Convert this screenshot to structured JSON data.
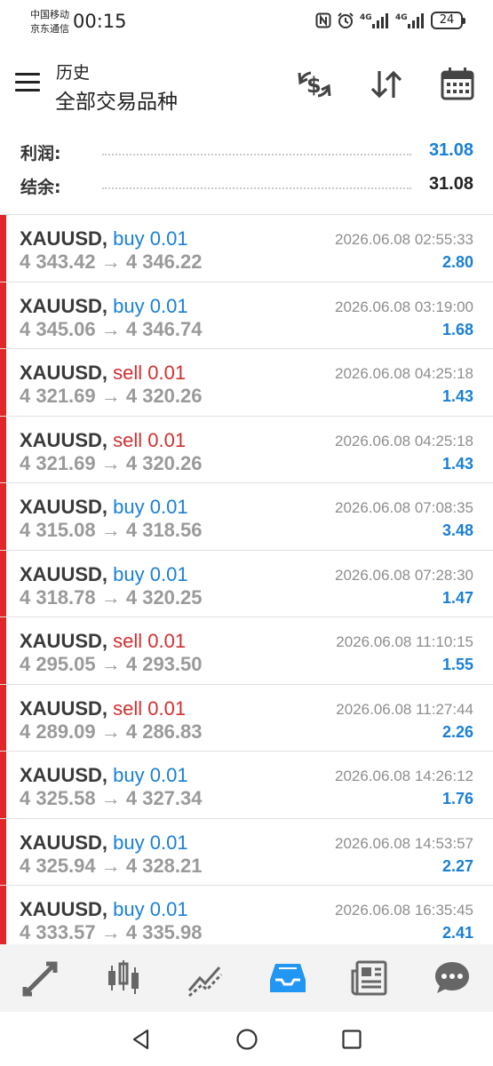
{
  "status_bar": {
    "carrier_1": "中国移动",
    "carrier_2": "京东通信",
    "time": "00:15",
    "signal_1_label": "4G",
    "signal_2_label": "4G",
    "battery": "24"
  },
  "header": {
    "subtitle": "历史",
    "title": "全部交易品种"
  },
  "summary": {
    "profit_label": "利润:",
    "profit_value": "31.08",
    "balance_label": "结余:",
    "balance_value": "31.08",
    "profit_color": "#1a80d6"
  },
  "colors": {
    "buy": "#1a80d6",
    "sell": "#d32f2f",
    "accent_bar": "#e02828",
    "nav_active": "#2196f3"
  },
  "deals": [
    {
      "symbol": "XAUUSD,",
      "type": "buy",
      "volume": "0.01",
      "prices": "4 343.42 → 4 346.22",
      "time": "2026.06.08 02:55:33",
      "profit": "2.80"
    },
    {
      "symbol": "XAUUSD,",
      "type": "buy",
      "volume": "0.01",
      "prices": "4 345.06 → 4 346.74",
      "time": "2026.06.08 03:19:00",
      "profit": "1.68"
    },
    {
      "symbol": "XAUUSD,",
      "type": "sell",
      "volume": "0.01",
      "prices": "4 321.69 → 4 320.26",
      "time": "2026.06.08 04:25:18",
      "profit": "1.43"
    },
    {
      "symbol": "XAUUSD,",
      "type": "sell",
      "volume": "0.01",
      "prices": "4 321.69 → 4 320.26",
      "time": "2026.06.08 04:25:18",
      "profit": "1.43"
    },
    {
      "symbol": "XAUUSD,",
      "type": "buy",
      "volume": "0.01",
      "prices": "4 315.08 → 4 318.56",
      "time": "2026.06.08 07:08:35",
      "profit": "3.48"
    },
    {
      "symbol": "XAUUSD,",
      "type": "buy",
      "volume": "0.01",
      "prices": "4 318.78 → 4 320.25",
      "time": "2026.06.08 07:28:30",
      "profit": "1.47"
    },
    {
      "symbol": "XAUUSD,",
      "type": "sell",
      "volume": "0.01",
      "prices": "4 295.05 → 4 293.50",
      "time": "2026.06.08 11:10:15",
      "profit": "1.55"
    },
    {
      "symbol": "XAUUSD,",
      "type": "sell",
      "volume": "0.01",
      "prices": "4 289.09 → 4 286.83",
      "time": "2026.06.08 11:27:44",
      "profit": "2.26"
    },
    {
      "symbol": "XAUUSD,",
      "type": "buy",
      "volume": "0.01",
      "prices": "4 325.58 → 4 327.34",
      "time": "2026.06.08 14:26:12",
      "profit": "1.76"
    },
    {
      "symbol": "XAUUSD,",
      "type": "buy",
      "volume": "0.01",
      "prices": "4 325.94 → 4 328.21",
      "time": "2026.06.08 14:53:57",
      "profit": "2.27"
    },
    {
      "symbol": "XAUUSD,",
      "type": "buy",
      "volume": "0.01",
      "prices": "4 333.57 → 4 335.98",
      "time": "2026.06.08 16:35:45",
      "profit": "2.41"
    }
  ],
  "icons": {
    "menu": "hamburger-icon",
    "currency_exchange": "currency-exchange-icon",
    "sort": "sort-arrows-icon",
    "calendar": "calendar-icon"
  },
  "bottom_nav": [
    {
      "id": "quotes",
      "icon": "quotes-arrows-icon",
      "active": false
    },
    {
      "id": "chart",
      "icon": "candlestick-icon",
      "active": false
    },
    {
      "id": "trade",
      "icon": "trade-chart-icon",
      "active": false
    },
    {
      "id": "history",
      "icon": "inbox-tray-icon",
      "active": true
    },
    {
      "id": "news",
      "icon": "newspaper-icon",
      "active": false
    },
    {
      "id": "messages",
      "icon": "chat-bubble-icon",
      "active": false
    }
  ]
}
